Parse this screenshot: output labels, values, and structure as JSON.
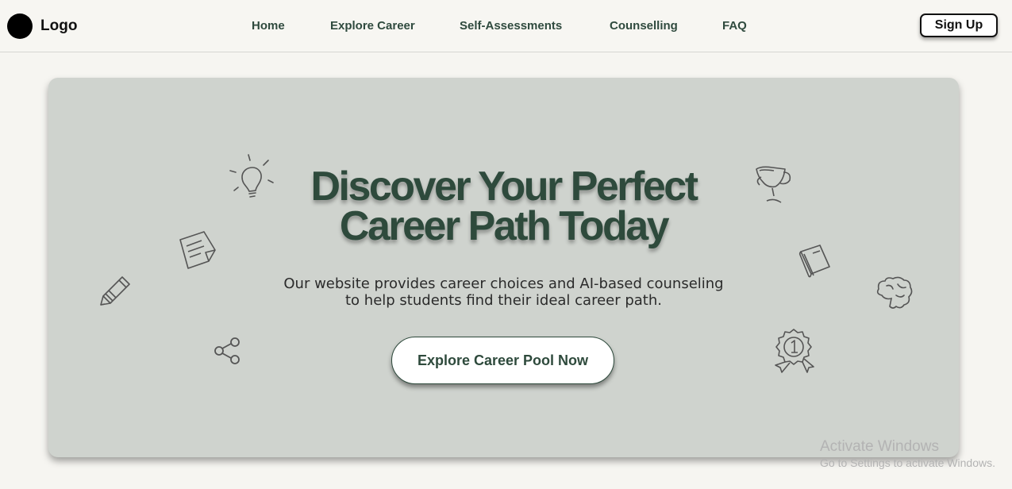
{
  "brand": {
    "logo_text": "Logo"
  },
  "nav": {
    "links": [
      {
        "label": "Home"
      },
      {
        "label": "Explore Career"
      },
      {
        "label": "Self-Assessments"
      },
      {
        "label": "Counselling"
      },
      {
        "label": "FAQ"
      }
    ],
    "signup_label": "Sign Up"
  },
  "hero": {
    "title_line1": "Discover Your Perfect",
    "title_line2": "Career Path Today",
    "subtitle_line1": "Our website provides career choices and AI-based counseling",
    "subtitle_line2": "to help students find their ideal career path.",
    "cta_label": "Explore Career Pool Now",
    "decorative_icons": [
      "lightbulb-icon",
      "note-icon",
      "pencil-icon",
      "share-icon",
      "trophy-icon",
      "book-icon",
      "brain-icon",
      "medal-icon"
    ]
  },
  "watermark": {
    "line1": "Activate Windows",
    "line2": "Go to Settings to activate Windows."
  },
  "colors": {
    "accent_green": "#2e4a3c",
    "hero_bg": "#cfd3ce",
    "page_bg": "#f6f5f1"
  }
}
